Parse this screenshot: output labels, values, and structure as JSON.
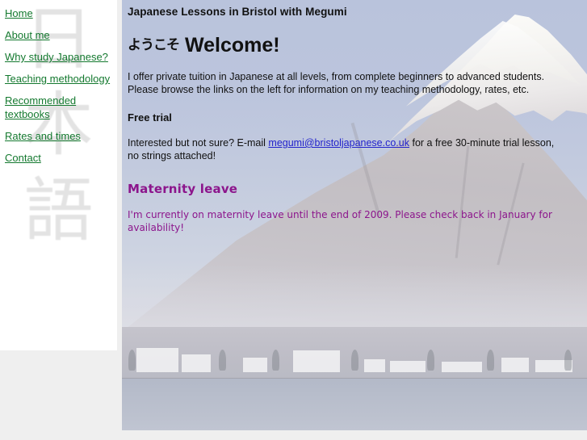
{
  "site": {
    "title": "Japanese Lessons in Bristol with Megumi"
  },
  "sidebar": {
    "watermark": {
      "char1": "日",
      "char2": "本",
      "char3": "語",
      "meaning": "Nihongo"
    },
    "items": [
      {
        "label": "Home"
      },
      {
        "label": "About me"
      },
      {
        "label": "Why study Japanese?"
      },
      {
        "label": "Teaching methodology"
      },
      {
        "label": "Recommended textbooks"
      },
      {
        "label": "Rates and times"
      },
      {
        "label": "Contact"
      }
    ]
  },
  "main": {
    "welcome": {
      "japanese": "ようこそ",
      "english": "Welcome!"
    },
    "intro": "I offer private tuition in Japanese at all levels, from complete beginners to advanced students. Please browse the links on the left for information on my teaching methodology, rates, etc.",
    "free_trial": {
      "heading": "Free trial",
      "text_before": "Interested but not sure? E-mail ",
      "email": "megumi@bristoljapanese.co.uk",
      "text_after": " for a free 30-minute trial lesson, no strings attached!"
    },
    "maternity": {
      "heading": "Maternity leave",
      "text": "I'm currently on maternity leave until the end of 2009. Please check back in January for availability!"
    }
  },
  "colors": {
    "nav_link": "#14792f",
    "email_link": "#2222cc",
    "maternity": "#8c158c",
    "content_bg": "#bcc5dc",
    "page_bg": "#efefef",
    "sidebar_bg": "#ffffff"
  }
}
